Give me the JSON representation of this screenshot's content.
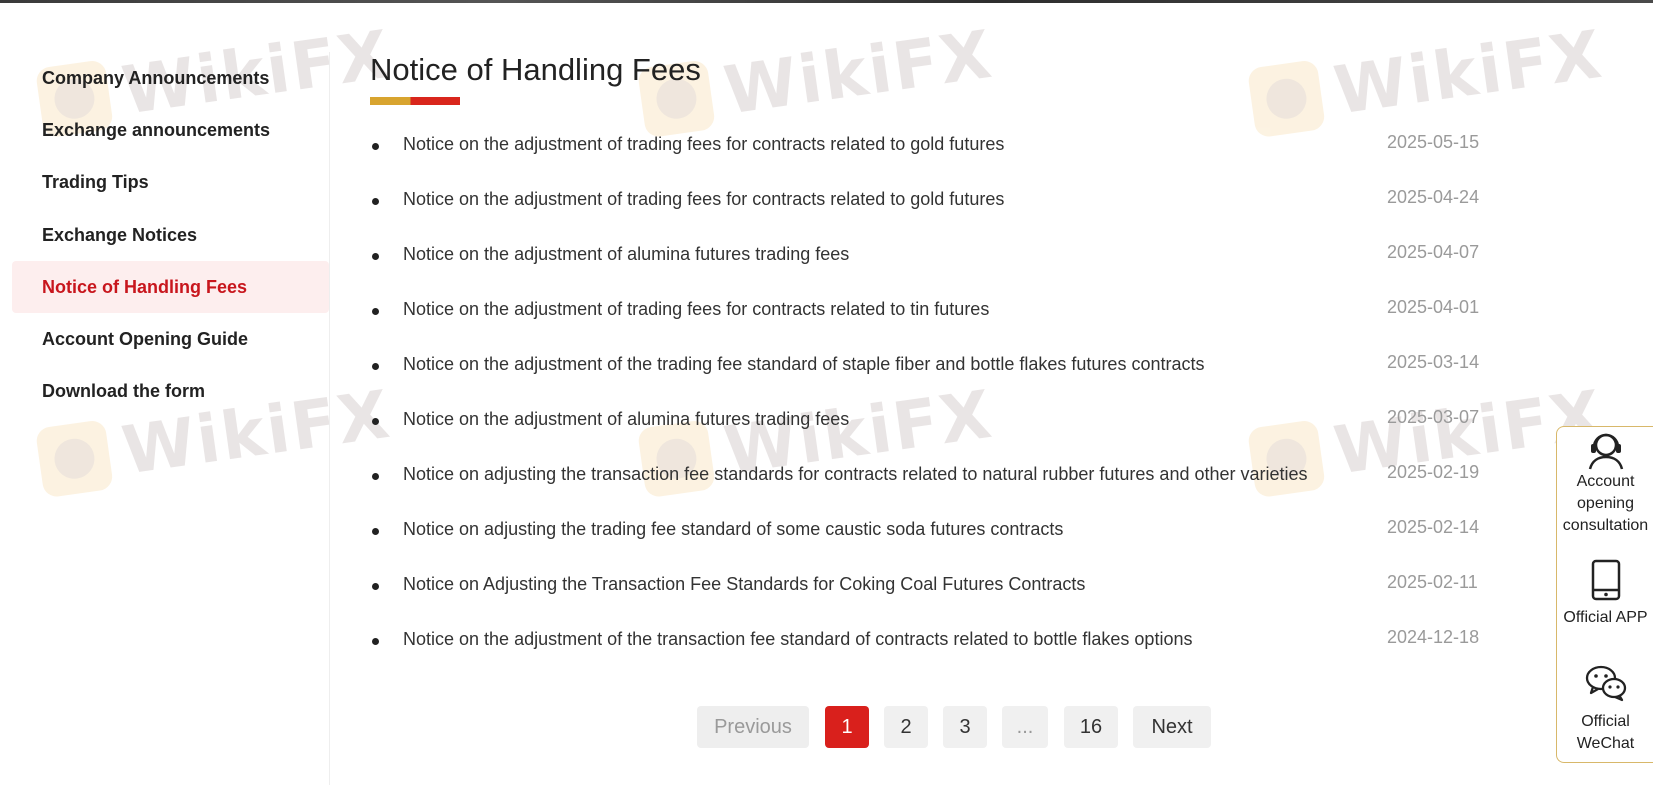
{
  "sidebar": {
    "items": [
      {
        "label": "Company Announcements",
        "active": false
      },
      {
        "label": "Exchange announcements",
        "active": false
      },
      {
        "label": "Trading Tips",
        "active": false
      },
      {
        "label": "Exchange Notices",
        "active": false
      },
      {
        "label": "Notice of Handling Fees",
        "active": true
      },
      {
        "label": "Account Opening Guide",
        "active": false
      },
      {
        "label": "Download the form",
        "active": false
      }
    ]
  },
  "main": {
    "title": "Notice of Handling Fees",
    "notices": [
      {
        "title": "Notice on the adjustment of trading fees for contracts related to gold futures",
        "date": "2025-05-15"
      },
      {
        "title": "Notice on the adjustment of trading fees for contracts related to gold futures",
        "date": "2025-04-24"
      },
      {
        "title": "Notice on the adjustment of alumina futures trading fees",
        "date": "2025-04-07"
      },
      {
        "title": "Notice on the adjustment of trading fees for contracts related to tin futures",
        "date": "2025-04-01"
      },
      {
        "title": "Notice on the adjustment of the trading fee standard of staple fiber and bottle flakes futures contracts",
        "date": "2025-03-14"
      },
      {
        "title": "Notice on the adjustment of alumina futures trading fees",
        "date": "2025-03-07"
      },
      {
        "title": "Notice on adjusting the transaction fee standards for contracts related to natural rubber futures and other varieties",
        "date": "2025-02-19"
      },
      {
        "title": "Notice on adjusting the trading fee standard of some caustic soda futures contracts",
        "date": "2025-02-14"
      },
      {
        "title": "Notice on Adjusting the Transaction Fee Standards for Coking Coal Futures Contracts",
        "date": "2025-02-11"
      },
      {
        "title": "Notice on the adjustment of the transaction fee standard of contracts related to bottle flakes options",
        "date": "2024-12-18"
      }
    ]
  },
  "pagination": {
    "previous": "Previous",
    "pages": [
      "1",
      "2",
      "3",
      "...",
      "16"
    ],
    "current": "1",
    "next": "Next"
  },
  "float_panel": {
    "consult_label": "Account opening consultation",
    "app_label": "Official APP",
    "wechat_label": "Official WeChat"
  },
  "watermark": {
    "text": "WikiFX"
  },
  "colors": {
    "accent": "#c8161d",
    "gold": "#d8a42f",
    "date": "#9a9a9a"
  }
}
